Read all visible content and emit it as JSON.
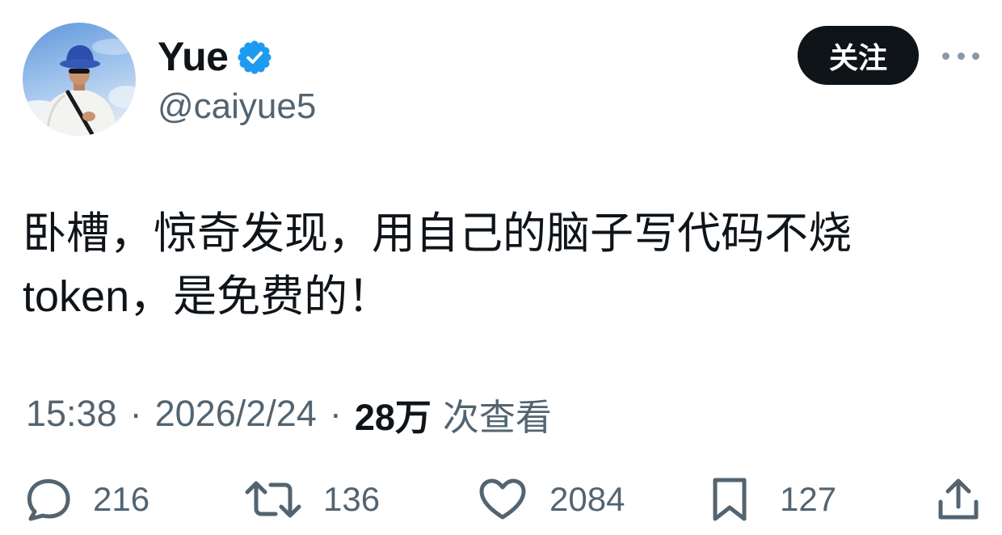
{
  "user": {
    "name": "Yue",
    "handle": "@caiyue5",
    "verified": true
  },
  "follow_button": {
    "label": "关注"
  },
  "tweet": {
    "body_lines": [
      "卧槽，惊奇发现，用自己的脑子写代码不烧",
      "token，是免费的！"
    ]
  },
  "meta": {
    "time": "15:38",
    "separator": "·",
    "date": "2026/2/24",
    "views_count": "28万",
    "views_label": "次查看"
  },
  "actions": {
    "reply": {
      "icon": "reply-icon",
      "count": "216"
    },
    "retweet": {
      "icon": "retweet-icon",
      "count": "136"
    },
    "like": {
      "icon": "heart-icon",
      "count": "2084"
    },
    "bookmark": {
      "icon": "bookmark-icon",
      "count": "127"
    },
    "share": {
      "icon": "share-icon"
    }
  },
  "icons": {
    "verified": "verified-badge-icon",
    "more": "more-horizontal-icon"
  },
  "colors": {
    "text": "#0f1419",
    "secondary": "#536471",
    "accent": "#1d9bf0",
    "button_bg": "#0f1419",
    "button_text": "#ffffff"
  }
}
